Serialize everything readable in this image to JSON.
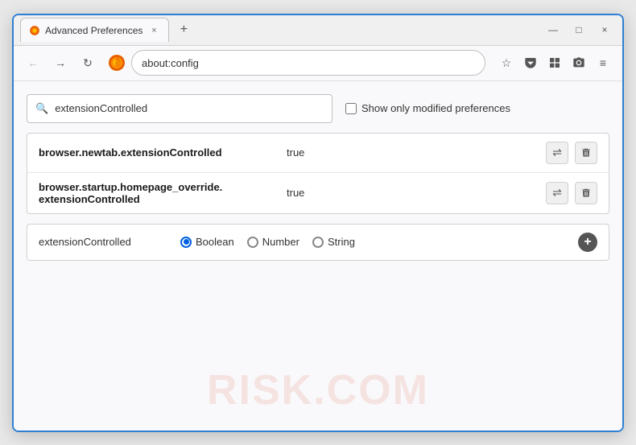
{
  "window": {
    "title": "Advanced Preferences",
    "tab_close": "×",
    "new_tab": "+",
    "min": "—",
    "max": "□",
    "close": "×"
  },
  "nav": {
    "back": "←",
    "forward": "→",
    "reload": "↻",
    "browser_name": "Firefox",
    "address": "about:config",
    "star": "☆",
    "shield": "🛡",
    "ext": "🧩",
    "pocket": "📥",
    "screenshot": "📷",
    "menu": "≡"
  },
  "search": {
    "placeholder": "extensionControlled",
    "value": "extensionControlled",
    "checkbox_label": "Show only modified preferences"
  },
  "results": [
    {
      "name": "browser.newtab.extensionControlled",
      "value": "true"
    },
    {
      "name": "browser.startup.homepage_override.\nextensionControlled",
      "name_line1": "browser.startup.homepage_override.",
      "name_line2": "extensionControlled",
      "value": "true",
      "multiline": true
    }
  ],
  "add_row": {
    "name": "extensionControlled",
    "types": [
      {
        "label": "Boolean",
        "selected": true
      },
      {
        "label": "Number",
        "selected": false
      },
      {
        "label": "String",
        "selected": false
      }
    ],
    "add_button": "+"
  },
  "watermark": "RISK.COM",
  "icons": {
    "search": "🔍",
    "toggle": "⇌",
    "delete": "🗑",
    "add": "+"
  }
}
